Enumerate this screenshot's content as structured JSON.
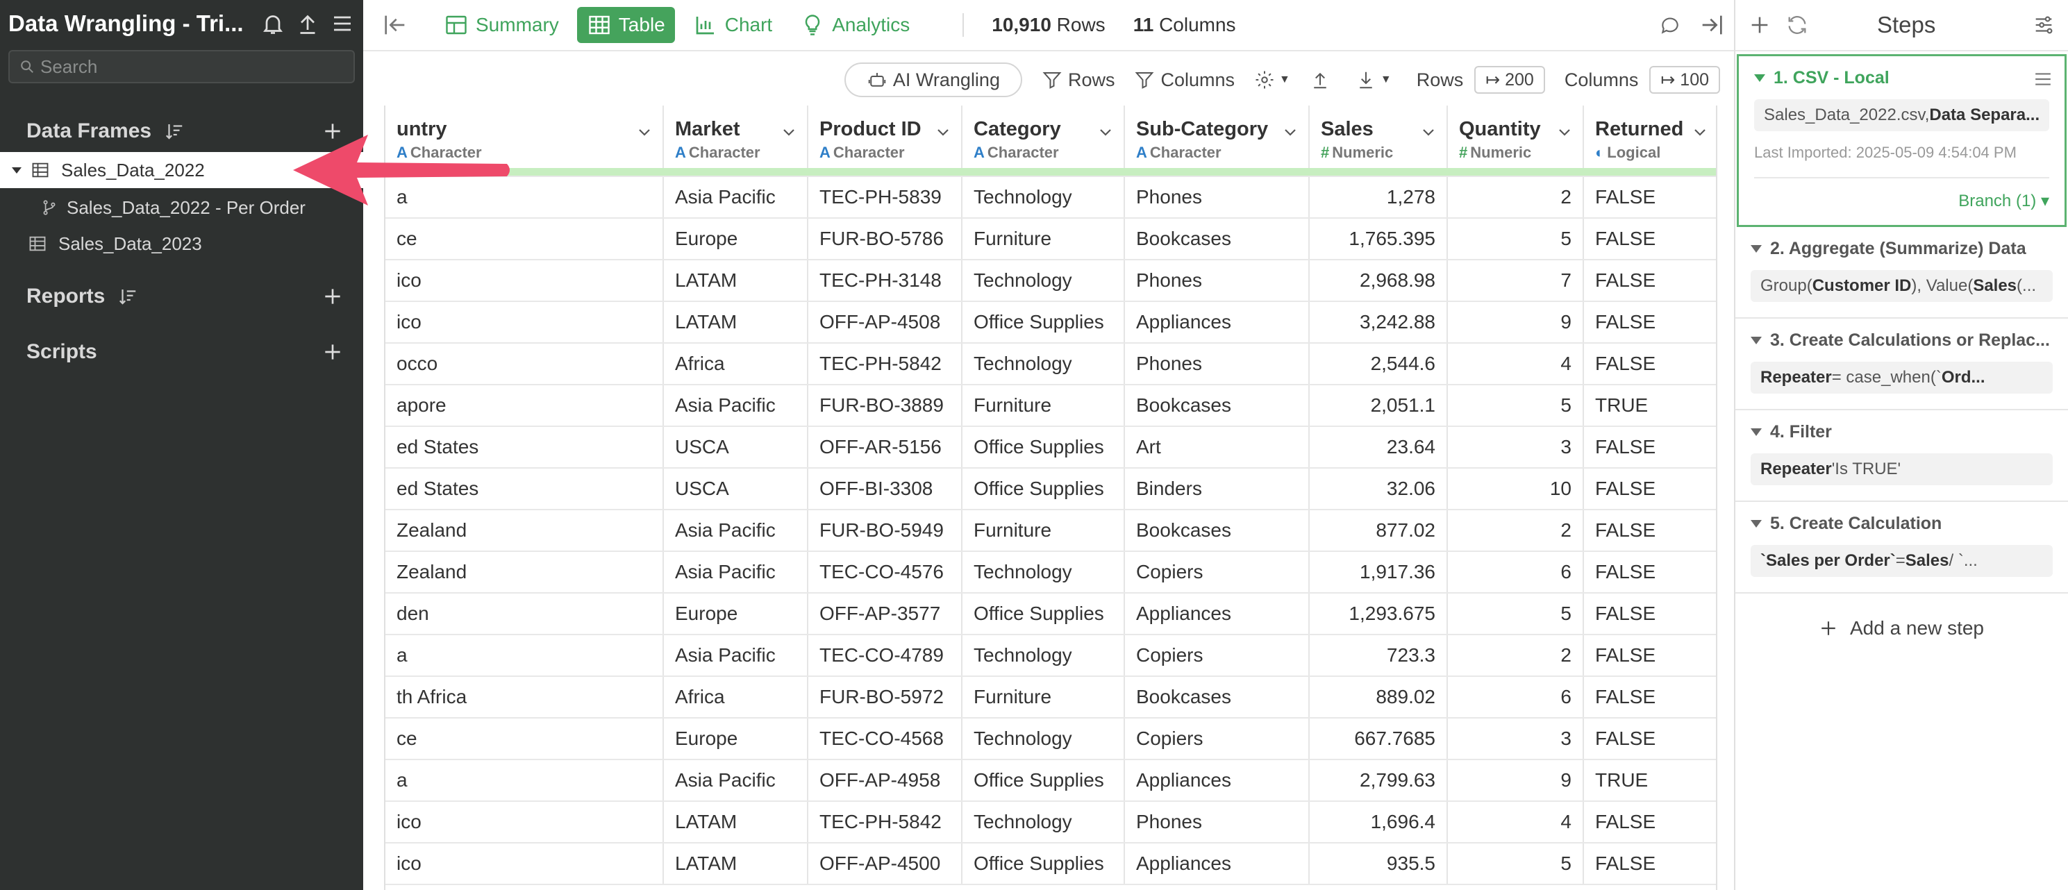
{
  "sidebar": {
    "title": "Data Wrangling - Tri...",
    "search_placeholder": "Search",
    "data_frames_label": "Data Frames",
    "reports_label": "Reports",
    "scripts_label": "Scripts",
    "items": [
      {
        "label": "Sales_Data_2022"
      },
      {
        "label": "Sales_Data_2022 - Per Order"
      },
      {
        "label": "Sales_Data_2023"
      }
    ]
  },
  "topbar": {
    "tabs": [
      {
        "label": "Summary"
      },
      {
        "label": "Table"
      },
      {
        "label": "Chart"
      },
      {
        "label": "Analytics"
      }
    ],
    "rows_count": "10,910",
    "rows_label": "Rows",
    "cols_count": "11",
    "cols_label": "Columns"
  },
  "toolbar": {
    "ai_label": "AI Wrangling",
    "rows_filter_label": "Rows",
    "columns_filter_label": "Columns",
    "rows_label": "Rows",
    "rows_value": "↦ 200",
    "columns_label": "Columns",
    "columns_value": "↦ 100"
  },
  "table": {
    "columns": [
      {
        "name": "untry",
        "type": "Character",
        "icon": "A"
      },
      {
        "name": "Market",
        "type": "Character",
        "icon": "A"
      },
      {
        "name": "Product ID",
        "type": "Character",
        "icon": "A"
      },
      {
        "name": "Category",
        "type": "Character",
        "icon": "A"
      },
      {
        "name": "Sub-Category",
        "type": "Character",
        "icon": "A"
      },
      {
        "name": "Sales",
        "type": "Numeric",
        "icon": "#"
      },
      {
        "name": "Quantity",
        "type": "Numeric",
        "icon": "#"
      },
      {
        "name": "Returned",
        "type": "Logical",
        "icon": "◐"
      }
    ],
    "rows": [
      [
        "a",
        "Asia Pacific",
        "TEC-PH-5839",
        "Technology",
        "Phones",
        "1,278",
        "2",
        "FALSE"
      ],
      [
        "ce",
        "Europe",
        "FUR-BO-5786",
        "Furniture",
        "Bookcases",
        "1,765.395",
        "5",
        "FALSE"
      ],
      [
        "ico",
        "LATAM",
        "TEC-PH-3148",
        "Technology",
        "Phones",
        "2,968.98",
        "7",
        "FALSE"
      ],
      [
        "ico",
        "LATAM",
        "OFF-AP-4508",
        "Office Supplies",
        "Appliances",
        "3,242.88",
        "9",
        "FALSE"
      ],
      [
        "occo",
        "Africa",
        "TEC-PH-5842",
        "Technology",
        "Phones",
        "2,544.6",
        "4",
        "FALSE"
      ],
      [
        "apore",
        "Asia Pacific",
        "FUR-BO-3889",
        "Furniture",
        "Bookcases",
        "2,051.1",
        "5",
        "TRUE"
      ],
      [
        "ed States",
        "USCA",
        "OFF-AR-5156",
        "Office Supplies",
        "Art",
        "23.64",
        "3",
        "FALSE"
      ],
      [
        "ed States",
        "USCA",
        "OFF-BI-3308",
        "Office Supplies",
        "Binders",
        "32.06",
        "10",
        "FALSE"
      ],
      [
        " Zealand",
        "Asia Pacific",
        "FUR-BO-5949",
        "Furniture",
        "Bookcases",
        "877.02",
        "2",
        "FALSE"
      ],
      [
        " Zealand",
        "Asia Pacific",
        "TEC-CO-4576",
        "Technology",
        "Copiers",
        "1,917.36",
        "6",
        "FALSE"
      ],
      [
        "den",
        "Europe",
        "OFF-AP-3577",
        "Office Supplies",
        "Appliances",
        "1,293.675",
        "5",
        "FALSE"
      ],
      [
        "a",
        "Asia Pacific",
        "TEC-CO-4789",
        "Technology",
        "Copiers",
        "723.3",
        "2",
        "FALSE"
      ],
      [
        "th Africa",
        "Africa",
        "FUR-BO-5972",
        "Furniture",
        "Bookcases",
        "889.02",
        "6",
        "FALSE"
      ],
      [
        "ce",
        "Europe",
        "TEC-CO-4568",
        "Technology",
        "Copiers",
        "667.7685",
        "3",
        "FALSE"
      ],
      [
        "a",
        "Asia Pacific",
        "OFF-AP-4958",
        "Office Supplies",
        "Appliances",
        "2,799.63",
        "9",
        "TRUE"
      ],
      [
        "ico",
        "LATAM",
        "TEC-PH-5842",
        "Technology",
        "Phones",
        "1,696.4",
        "4",
        "FALSE"
      ],
      [
        "ico",
        "LATAM",
        "OFF-AP-4500",
        "Office Supplies",
        "Appliances",
        "935.5",
        "5",
        "FALSE"
      ]
    ]
  },
  "steps": {
    "title": "Steps",
    "items": [
      {
        "title": "1. CSV - Local",
        "desc_plain": "Sales_Data_2022.csv, ",
        "desc_bold": "Data Separa...",
        "meta": "Last Imported: 2025-05-09 4:54:04 PM",
        "branch": "Branch (1) ▾"
      },
      {
        "title": "2. Aggregate (Summarize) Data",
        "d1": "Group(",
        "d2": "Customer ID",
        "d3": "), Value(",
        "d4": "Sales",
        "d5": " (..."
      },
      {
        "title": "3. Create Calculations or Replac...",
        "d1": "Repeater",
        "d2": " = case_when(`",
        "d3": "Ord..."
      },
      {
        "title": "4. Filter",
        "d1": "Repeater",
        "d2": " 'Is TRUE'"
      },
      {
        "title": "5. Create Calculation",
        "d1": "`Sales per Order`",
        "d2": " = ",
        "d3": "Sales",
        "d4": " / `..."
      }
    ],
    "add_label": "Add a new step"
  },
  "colors": {
    "accent": "#45a35c",
    "sidebar_bg": "#2e3130",
    "arrow": "#ee4a6a",
    "quality_bar": "#c7eec0"
  }
}
